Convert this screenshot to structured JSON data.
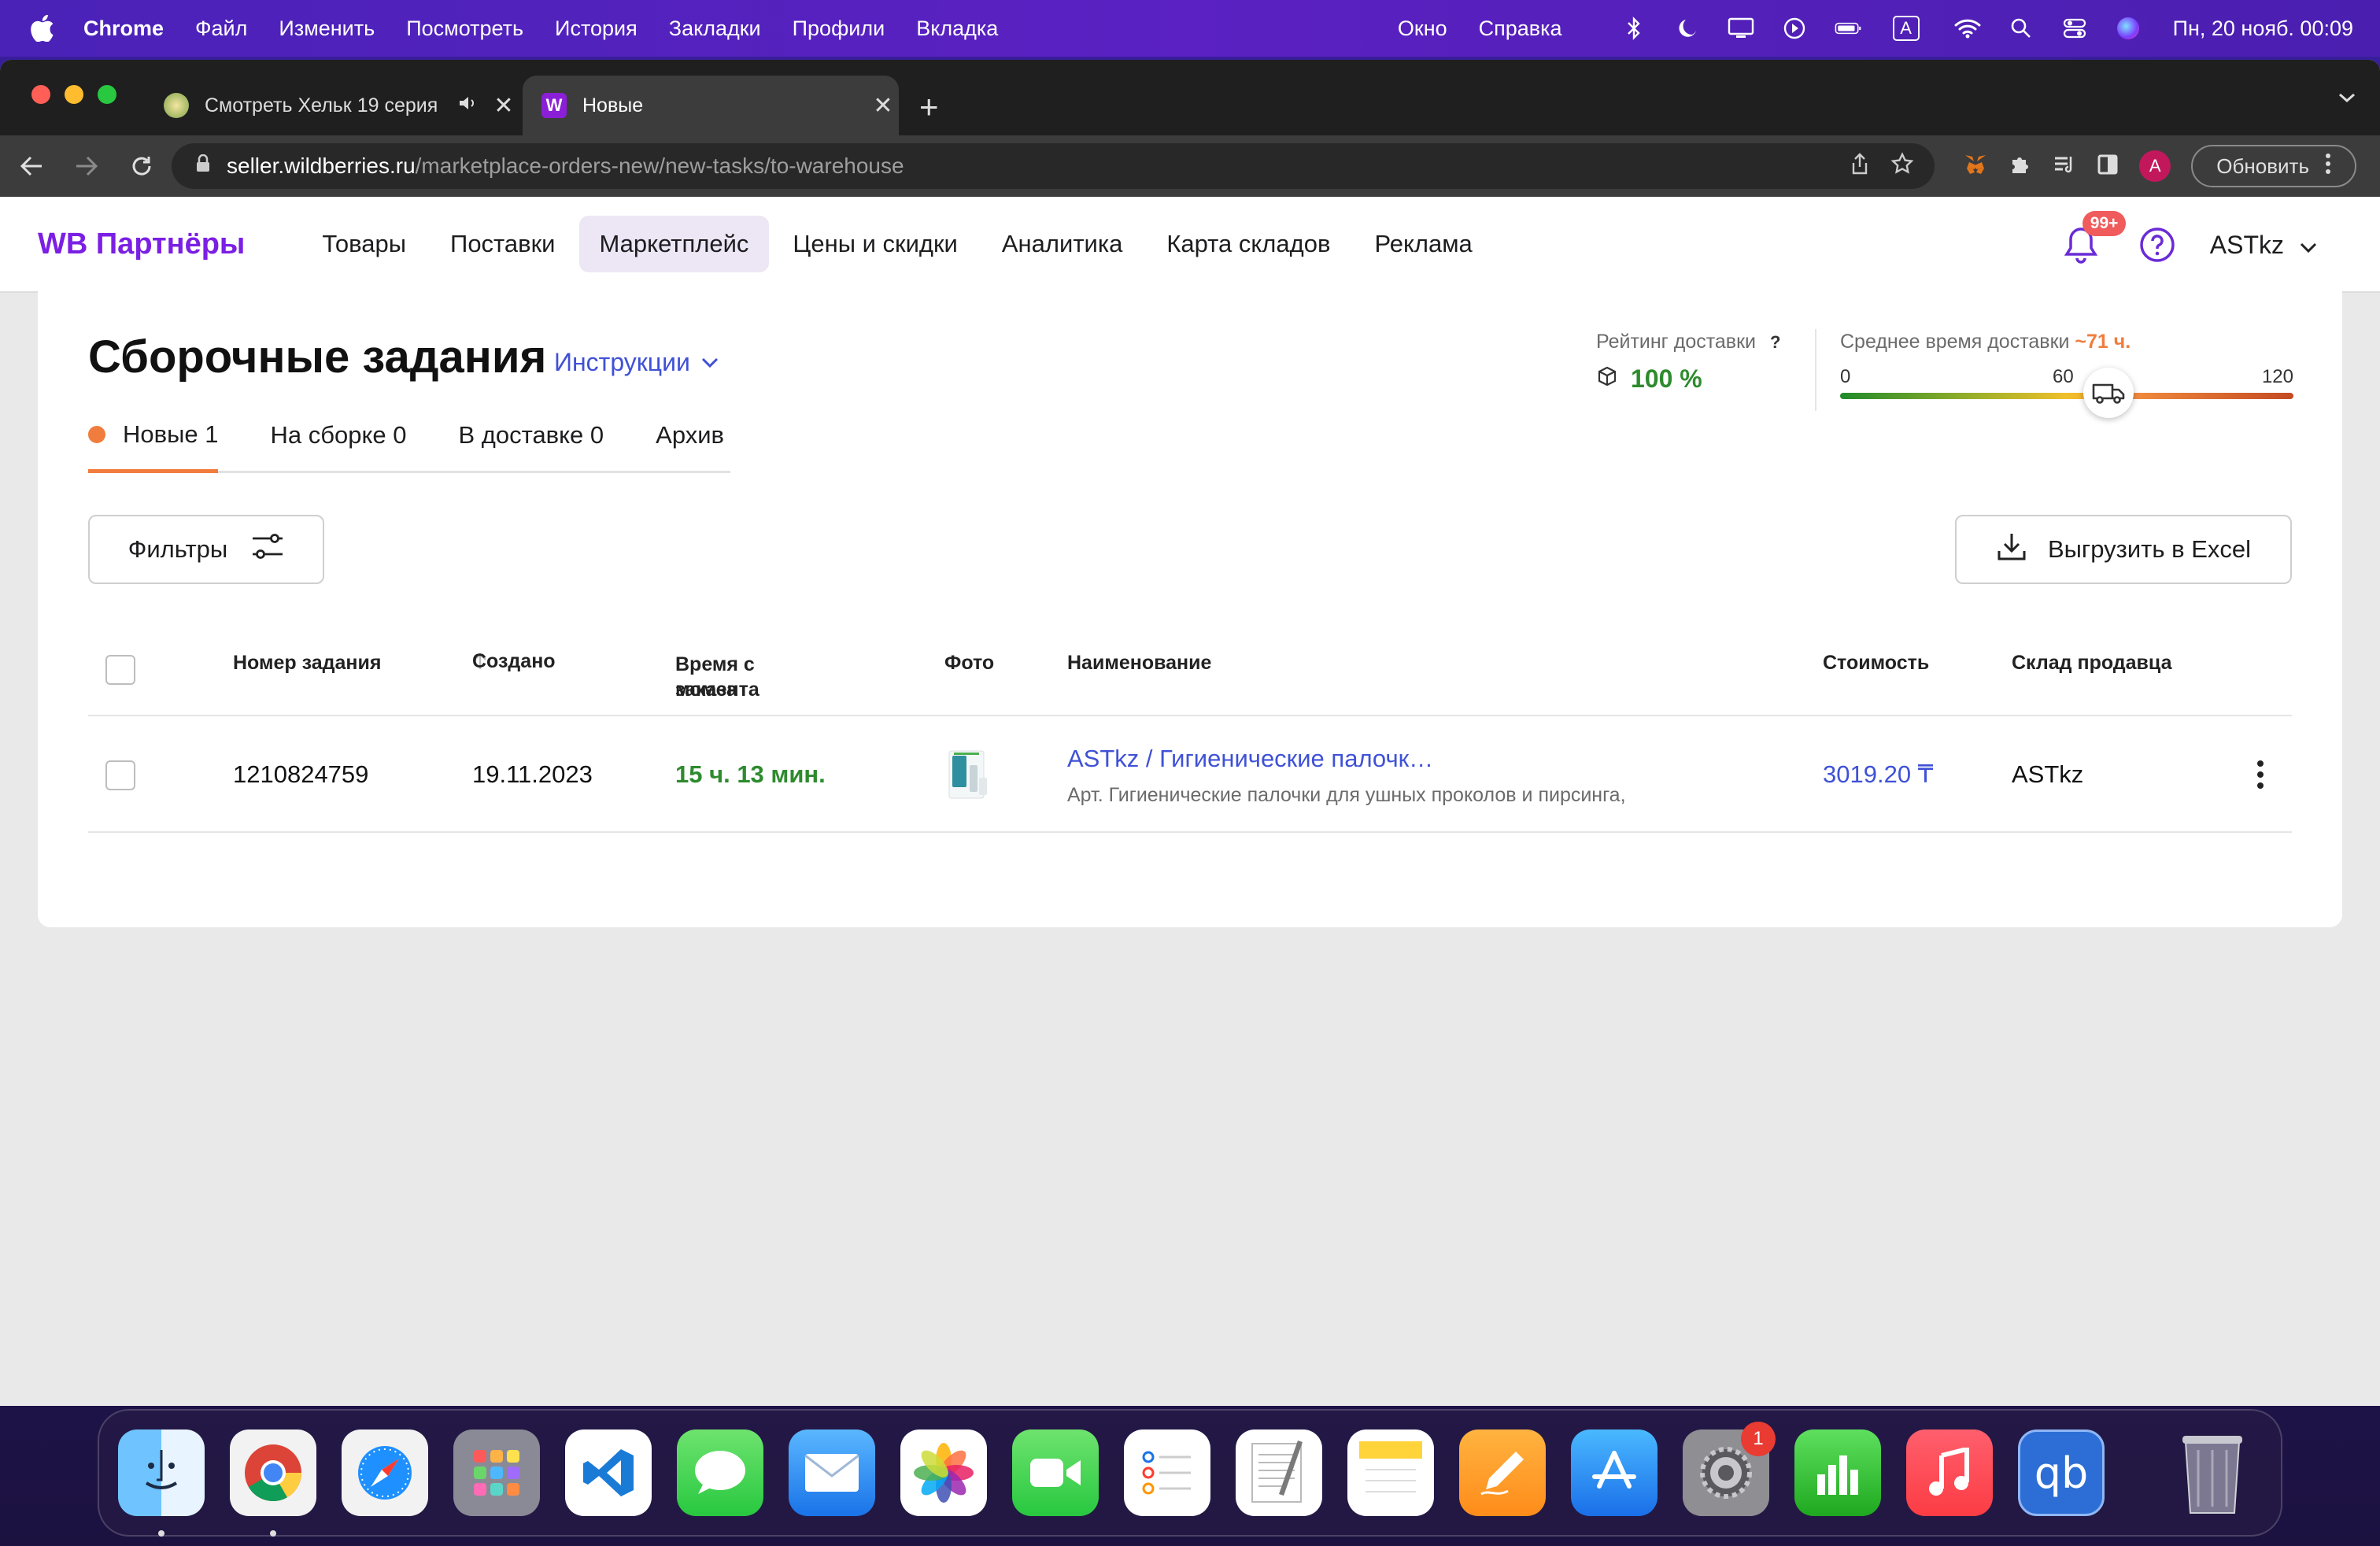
{
  "menubar": {
    "app": "Chrome",
    "items": [
      "Файл",
      "Изменить",
      "Посмотреть",
      "История",
      "Закладки",
      "Профили",
      "Вкладка"
    ],
    "right_items": [
      "Окно",
      "Справка"
    ],
    "clock": "Пн, 20 нояб.  00:09",
    "keyboard": "A"
  },
  "browser": {
    "tabs": [
      {
        "title": "Смотреть Хельк 19 серия",
        "active": false
      },
      {
        "title": "Новые",
        "active": true
      }
    ],
    "url_host": "seller.wildberries.ru",
    "url_path": "/marketplace-orders-new/new-tasks/to-warehouse",
    "profile_initial": "A",
    "update_label": "Обновить"
  },
  "nav": {
    "logo": "WB Партнёры",
    "items": [
      "Товары",
      "Поставки",
      "Маркетплейс",
      "Цены и скидки",
      "Аналитика",
      "Карта складов",
      "Реклама"
    ],
    "active": "Маркетплейс",
    "notifications": "99+",
    "account": "ASTkz"
  },
  "page": {
    "title": "Сборочные задания",
    "instructions": "Инструкции",
    "tabs": [
      {
        "label": "Новые 1",
        "active": true
      },
      {
        "label": "На сборке 0",
        "active": false
      },
      {
        "label": "В доставке 0",
        "active": false
      },
      {
        "label": "Архив",
        "active": false
      }
    ],
    "rating": {
      "label": "Рейтинг доставки",
      "help": "?",
      "value": "100 %"
    },
    "avg_delivery": {
      "label": "Среднее время доставки",
      "value": "~71 ч.",
      "ticks": [
        "0",
        "60",
        "120"
      ],
      "level": 71
    },
    "filters_label": "Фильтры",
    "excel_label": "Выгрузить в Excel",
    "table": {
      "columns": {
        "id": "Номер задания",
        "created": "Создано",
        "time_a": "Время с момента",
        "time_b": "заказа",
        "photo": "Фото",
        "name": "Наименование",
        "price": "Стоимость",
        "warehouse": "Склад продавца"
      },
      "rows": [
        {
          "id": "1210824759",
          "created": "19.11.2023",
          "time": "15 ч. 13 мин.",
          "name": "ASTkz / Гигиенические палочк…",
          "article": "Арт. Гигиенические палочки для ушных проколов и пирсинга,",
          "price": "3019.20 ₸",
          "warehouse": "ASTkz"
        }
      ]
    }
  },
  "dock": {
    "apps": [
      "finder",
      "chrome",
      "safari",
      "launchpad",
      "vscode",
      "messages",
      "mail",
      "photos",
      "facetime",
      "reminders",
      "textedit",
      "notes",
      "pages",
      "app-store",
      "system-settings",
      "numbers",
      "music",
      "qbittorrent"
    ],
    "settings_badge": "1",
    "qb_label": "qb"
  }
}
